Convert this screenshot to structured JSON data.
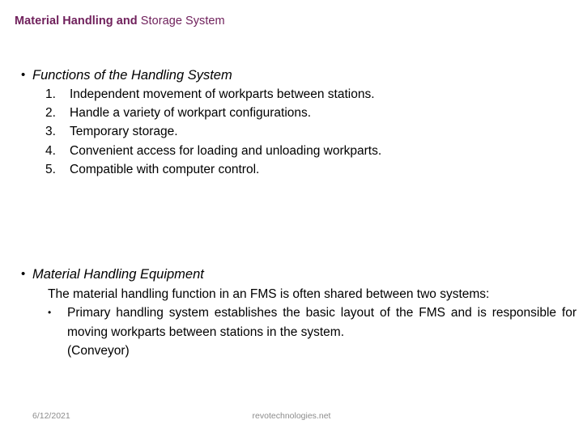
{
  "slide": {
    "title_part_bold": "Material Handling and",
    "title_part_normal": " Storage System",
    "title_color": "#70215C",
    "background_color": "#FFFFFF"
  },
  "content": {
    "bullet_glyph": "•",
    "groups": [
      {
        "heading": "Functions of the Handling System",
        "numbered_items": [
          {
            "marker": "1.",
            "text": "Independent movement of workparts between stations."
          },
          {
            "marker": "2.",
            "text": "Handle a variety of workpart configurations."
          },
          {
            "marker": "3.",
            "text": "Temporary storage."
          },
          {
            "marker": "4.",
            "text": "Convenient access for loading and unloading workparts."
          },
          {
            "marker": "5.",
            "text": "Compatible with computer control."
          }
        ]
      },
      {
        "heading": "Material Handling Equipment",
        "intro": "The material handling function in an FMS is often shared between two systems:",
        "sub_bullet_text": "Primary handling system establishes the basic layout of the FMS and is responsible for moving workparts between stations in the system.",
        "sub_bullet_last_line": "(Conveyor)"
      }
    ]
  },
  "footer": {
    "date": "6/12/2021",
    "site": "revotechnologies.net",
    "color": "#8C8C8C"
  }
}
